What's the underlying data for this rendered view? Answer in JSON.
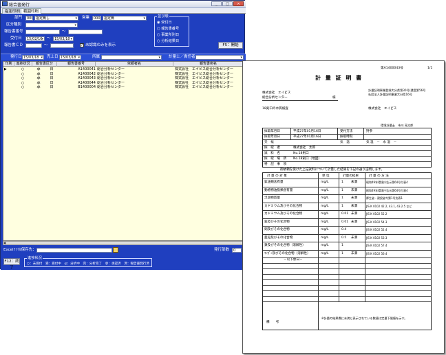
{
  "window": {
    "title": "総合書発行"
  },
  "tabs": [
    "指定印刷",
    "範囲印刷"
  ],
  "filters": {
    "busho_label": "部門",
    "busho_code": "000",
    "busho_value": "指定無し",
    "eigyo_label": "営業",
    "eigyo_code": "000",
    "eigyo_value": "指定無",
    "kubun_label": "区分種別",
    "report_label": "報告書番号",
    "tilde": "～",
    "uketsuke_label": "受付日",
    "uketsuke_from": "15/02/16",
    "uketsuke_to": "15/03/18",
    "miho_label": "報告書ＣＤ",
    "miho_checkbox_label": "未認識のみを表示",
    "hakkou_label": "発行日",
    "hakkou_from": "15/03/18",
    "uriage_label": "売上日",
    "uriage_from": "15/03/18",
    "shomei_label": "所属",
    "kigyou_label": "計量士／責任者",
    "output_group_title": "並び順",
    "output_options": [
      "受付日",
      "報告書番号",
      "事業所別日",
      "分析結果日"
    ],
    "search_button": "F5：開始"
  },
  "grid": {
    "headers": [
      "印刷",
      "進捗状況",
      "報告書区分",
      "報告書番号",
      "依頼者名",
      "報告書宛名"
    ],
    "rows": [
      {
        "mark": "▶",
        "status": "○",
        "kubun": "承",
        "type": "日",
        "number": "A1400041",
        "client": "総合分析センター",
        "addressee": "株式会社　エイビス総合分析センター"
      },
      {
        "mark": "",
        "status": "○",
        "kubun": "承",
        "type": "日",
        "number": "A1400042",
        "client": "総合分析センター",
        "addressee": "株式会社　エイビス総合分析センター"
      },
      {
        "mark": "",
        "status": "○",
        "kubun": "承",
        "type": "日",
        "number": "A1400043",
        "client": "総合分析センター",
        "addressee": "株式会社　エイビス総合分析センター"
      },
      {
        "mark": "",
        "status": "○",
        "kubun": "承",
        "type": "日",
        "number": "A1400044",
        "client": "総合分析センター",
        "addressee": "株式会社　エイビス総合分析センター"
      },
      {
        "mark": "",
        "status": "○",
        "kubun": "承",
        "type": "日",
        "number": "B1400004",
        "client": "総合分析センター",
        "addressee": "株式会社　エイビス総合分析センター"
      }
    ]
  },
  "footer": {
    "excel_label": "Excelﾌｧｲﾙ保存先：",
    "excel_value": "",
    "issued_label": "発行部数",
    "issued_value": "0",
    "exit_button": "F12：終了",
    "legend_title": "進捗状況",
    "legend_text": "○：未受付　受：受付中　◎：分析中　完：分析完了　承：承認済　済：報告書発行済"
  },
  "paper": {
    "page_no": "第A1400043号",
    "page_count": "1/1",
    "title": "計 量 証 明 書",
    "to_company": "株式会社　エイビス",
    "to_dept": "総合分析センター",
    "honorific": "様",
    "issuer_reg1": "計量証明事業登録大分県第30号(濃度第56号",
    "issuer_reg2": "社団法人計量証明事業大分県16号",
    "issuer_company": "株式会社　エイビス",
    "sample_label": "18剣口の水質検査",
    "signer": "環境計量士　市川 亮太郎",
    "info": [
      {
        "label": "採取年月日",
        "value": "平成27年01月16日",
        "label2": "受付方法",
        "value2": "持参"
      },
      {
        "label": "採取年月日",
        "value": "平成27年01月16日",
        "label2": "採取時刻",
        "value2": ""
      },
      {
        "label": "天　候",
        "value": "",
        "label2": "気　温",
        "value2": "気 温　－　水 温　－"
      },
      {
        "label": "採　取　者",
        "value": "株式会社　太郎",
        "label2": "",
        "value2": ""
      },
      {
        "label": "試　料　名",
        "value": "No.18剣口",
        "label2": "",
        "value2": ""
      },
      {
        "label": "採　取　場　所",
        "value": "No.18剣口（地図）",
        "label2": "",
        "value2": ""
      },
      {
        "label": "特　記　事　項",
        "value": "",
        "label2": "",
        "value2": ""
      }
    ],
    "intro": "御依頼を受けた上記試料について計量した結果を下記の通り証明します。",
    "result_headers": [
      "計 量 の 対 象",
      "単 位",
      "計量の結果",
      "計 量 の 方 法"
    ],
    "results": [
      {
        "item": "鉱油類含有量",
        "unit": "mg/L",
        "result": "1",
        "note": "未満",
        "method": "昭和49年環境庁告示第64号付表4"
      },
      {
        "item": "動植物油脂類含有量",
        "unit": "mg/L",
        "result": "1",
        "note": "未満",
        "method": "昭和49年環境庁告示第64号付表4"
      },
      {
        "item": "浮遊物質量",
        "unit": "mg/L",
        "result": "1",
        "note": "未満",
        "method": "厚生省・建設省令第1号別表1"
      },
      {
        "item": "カドミウム及びその化合物",
        "unit": "mg/L",
        "result": "1",
        "note": "未満",
        "method": "JIS K 0102 42.2, 43.1, 43.2.5 など"
      },
      {
        "item": "カドミウム及びその化合物",
        "unit": "mg/L",
        "result": "0.01",
        "note": "未満",
        "method": "JIS K 0102 55.2"
      },
      {
        "item": "鉛及びその化合物",
        "unit": "mg/L",
        "result": "0.01",
        "note": "未満",
        "method": "JIS K 0102 54.3"
      },
      {
        "item": "銅及びその化合物",
        "unit": "mg/L",
        "result": "0.4",
        "note": "",
        "method": "JIS K 0102 52.4"
      },
      {
        "item": "亜鉛及びその化合物",
        "unit": "mg/L",
        "result": "0.5",
        "note": "未満",
        "method": "JIS K 0102 53.3"
      },
      {
        "item": "鉄及びその化合物（溶解性）",
        "unit": "mg/L",
        "result": "1",
        "note": "",
        "method": "JIS K 0102 57.4"
      },
      {
        "item": "ﾏﾝｶﾞﾝ及びその化合物（溶解性）",
        "unit": "mg/L",
        "result": "1",
        "note": "未満",
        "method": "JIS K 0102 56.4"
      }
    ],
    "below_blank": "－以下余白－",
    "bikou_label": "備　　考",
    "bikou_text": "※計量の結果欄に未満と表示されている数値は定量下限値を示す。"
  }
}
